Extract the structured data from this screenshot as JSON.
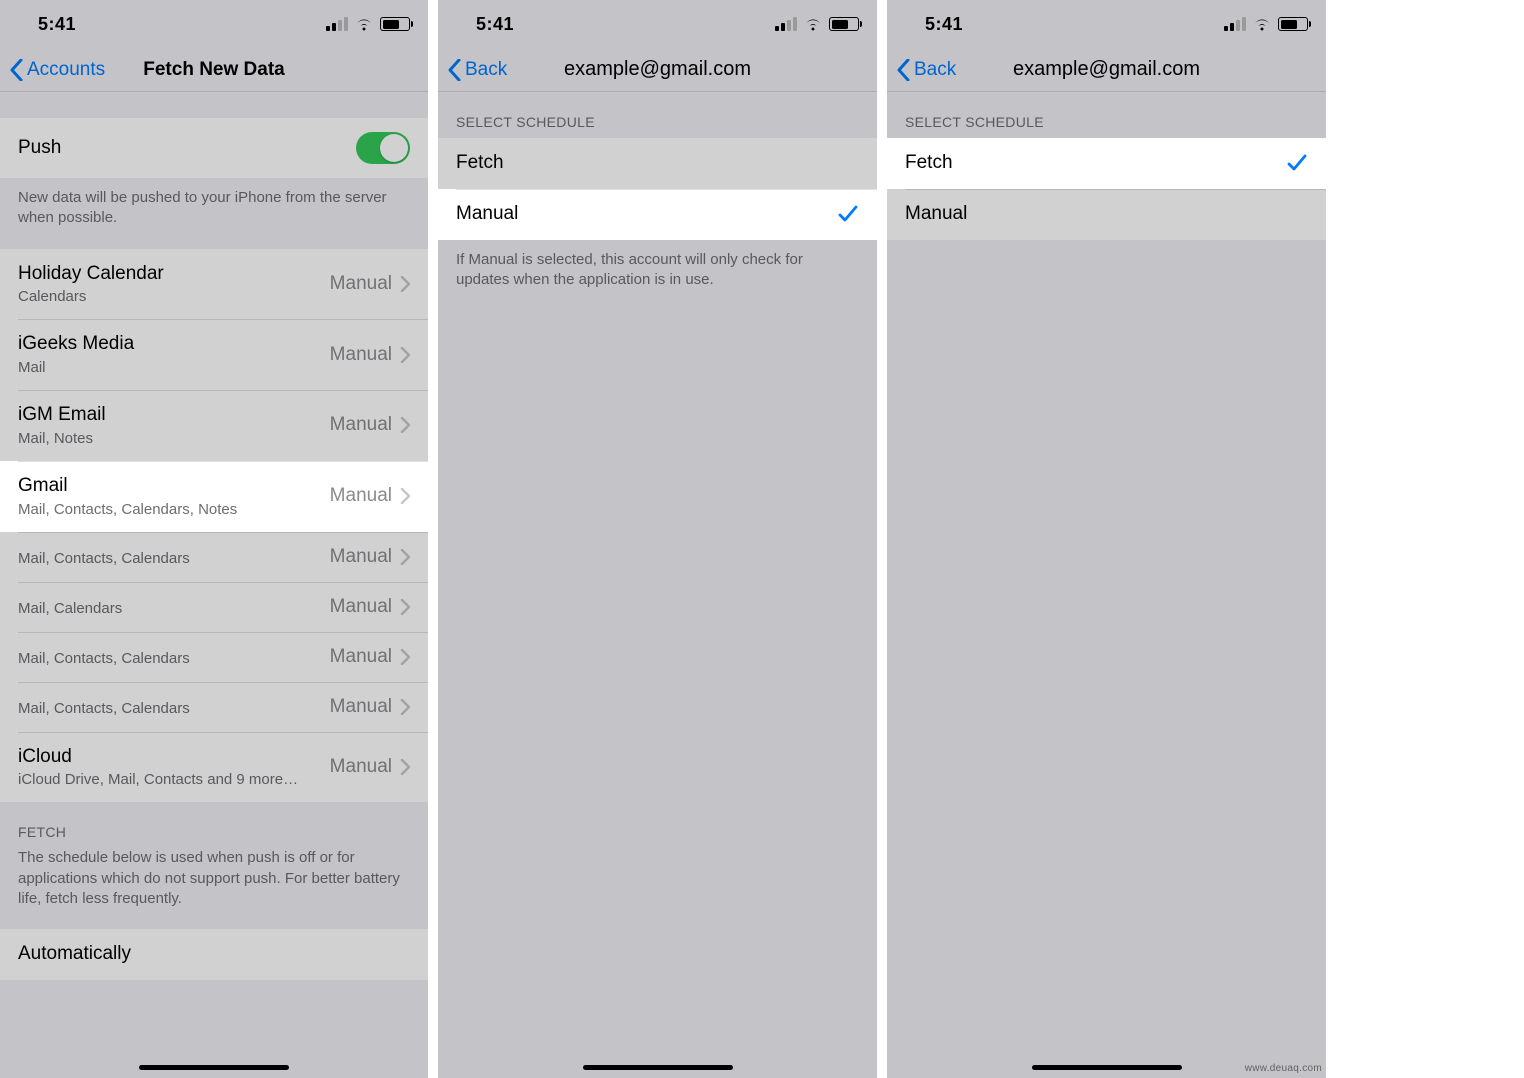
{
  "status": {
    "time": "5:41"
  },
  "colors": {
    "tint": "#007aff",
    "switch_on": "#34c759"
  },
  "screen1": {
    "back_label": "Accounts",
    "title": "Fetch New Data",
    "push": {
      "label": "Push",
      "footer": "New data will be pushed to your iPhone from the server when possible."
    },
    "accounts": [
      {
        "name": "Holiday Calendar",
        "sub": "Calendars",
        "schedule": "Manual"
      },
      {
        "name": "iGeeks Media",
        "sub": "Mail",
        "schedule": "Manual"
      },
      {
        "name": "iGM Email",
        "sub": "Mail, Notes",
        "schedule": "Manual"
      },
      {
        "name": "Gmail",
        "sub": "Mail, Contacts, Calendars, Notes",
        "schedule": "Manual",
        "highlight": true
      },
      {
        "name": "",
        "sub": "Mail, Contacts, Calendars",
        "schedule": "Manual"
      },
      {
        "name": "",
        "sub": "Mail, Calendars",
        "schedule": "Manual"
      },
      {
        "name": "",
        "sub": "Mail, Contacts, Calendars",
        "schedule": "Manual"
      },
      {
        "name": "",
        "sub": "Mail, Contacts, Calendars",
        "schedule": "Manual"
      },
      {
        "name": "iCloud",
        "sub": "iCloud Drive, Mail, Contacts and 9 more…",
        "schedule": "Manual"
      }
    ],
    "fetch_header": "FETCH",
    "fetch_footer": "The schedule below is used when push is off or for applications which do not support push. For better battery life, fetch less frequently.",
    "fetch_option": "Automatically"
  },
  "screen2": {
    "back_label": "Back",
    "title": "example@gmail.com",
    "section_header": "SELECT SCHEDULE",
    "options": {
      "fetch": "Fetch",
      "manual": "Manual"
    },
    "selected": "manual",
    "footer": "If Manual is selected, this account will only check for updates when the application is in use."
  },
  "screen3": {
    "back_label": "Back",
    "title": "example@gmail.com",
    "section_header": "SELECT SCHEDULE",
    "options": {
      "fetch": "Fetch",
      "manual": "Manual"
    },
    "selected": "fetch"
  },
  "watermark": "www.deuaq.com"
}
